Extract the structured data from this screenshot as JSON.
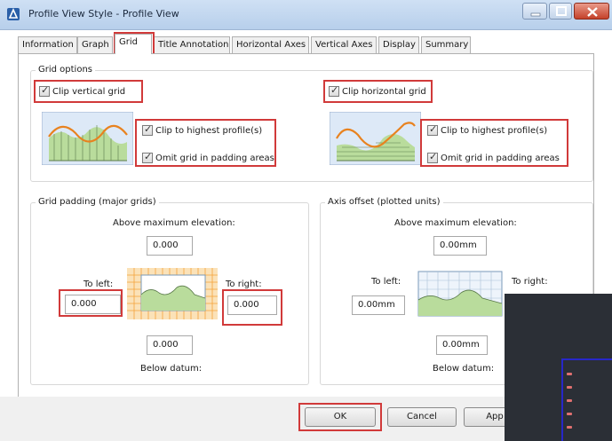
{
  "window": {
    "title": "Profile View Style - Profile View"
  },
  "tabs": [
    {
      "label": "Information"
    },
    {
      "label": "Graph"
    },
    {
      "label": "Grid"
    },
    {
      "label": "Title Annotation"
    },
    {
      "label": "Horizontal Axes"
    },
    {
      "label": "Vertical Axes"
    },
    {
      "label": "Display"
    },
    {
      "label": "Summary"
    }
  ],
  "grid_options": {
    "label": "Grid options",
    "clip_vertical": {
      "label": "Clip vertical grid",
      "checked": true
    },
    "clip_horizontal": {
      "label": "Clip horizontal grid",
      "checked": true
    },
    "left_clip_highest": {
      "label": "Clip to highest profile(s)",
      "checked": true
    },
    "left_omit_padding": {
      "label": "Omit grid in padding areas",
      "checked": true
    },
    "right_clip_highest": {
      "label": "Clip to highest profile(s)",
      "checked": true
    },
    "right_omit_padding": {
      "label": "Omit grid in padding areas",
      "checked": true
    }
  },
  "grid_padding": {
    "label": "Grid padding (major grids)",
    "above_label": "Above maximum elevation:",
    "above_value": "0.000",
    "left_label": "To left:",
    "left_value": "0.000",
    "right_label": "To right:",
    "right_value": "0.000",
    "below_value": "0.000",
    "below_label": "Below datum:"
  },
  "axis_offset": {
    "label": "Axis offset (plotted units)",
    "above_label": "Above maximum elevation:",
    "above_value": "0.00mm",
    "left_label": "To left:",
    "left_value": "0.00mm",
    "right_label": "To right:",
    "below_value": "0.00mm",
    "below_label": "Below datum:"
  },
  "buttons": {
    "ok": "OK",
    "cancel": "Cancel",
    "apply": "App"
  },
  "colors": {
    "highlight": "#d13a3a",
    "profile_fill": "#b9dc9c",
    "profile_line": "#e8821f",
    "padding_grid": "#f4a23a"
  }
}
